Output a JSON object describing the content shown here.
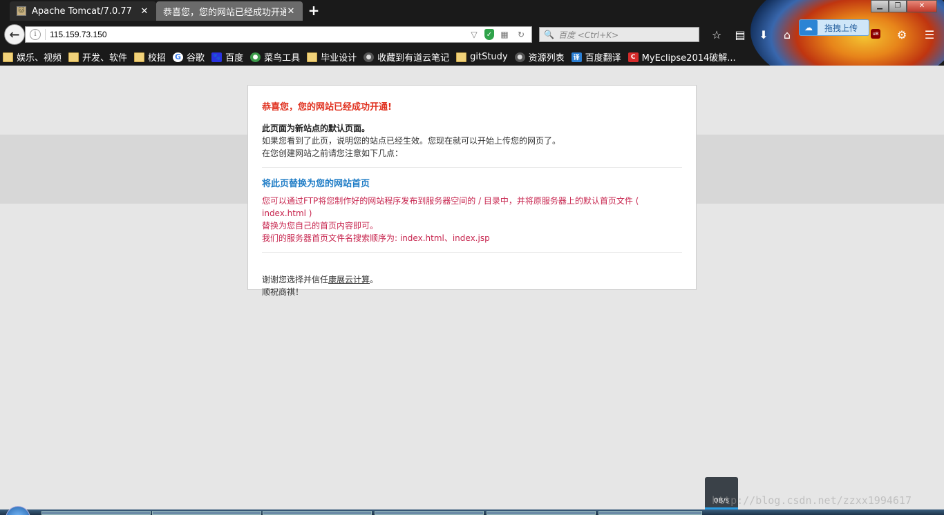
{
  "tabs": [
    {
      "title": "Apache Tomcat/7.0.77",
      "active": false
    },
    {
      "title": "恭喜您，您的网站已经成功开通!",
      "active": true
    }
  ],
  "url": "115.159.73.150",
  "search_placeholder": "百度 <Ctrl+K>",
  "upload_label": "拖拽上传",
  "bookmarks": [
    {
      "label": "娱乐、视频",
      "icon": "folder-icon"
    },
    {
      "label": "开发、软件",
      "icon": "folder-icon"
    },
    {
      "label": "校招",
      "icon": "folder-icon"
    },
    {
      "label": "谷歌",
      "icon": "google-icon"
    },
    {
      "label": "百度",
      "icon": "baidu-icon"
    },
    {
      "label": "菜鸟工具",
      "icon": "runoob-icon"
    },
    {
      "label": "毕业设计",
      "icon": "folder-icon"
    },
    {
      "label": "收藏到有道云笔记",
      "icon": "youdao-icon"
    },
    {
      "label": "gitStudy",
      "icon": "folder-icon"
    },
    {
      "label": "资源列表",
      "icon": "globe-icon"
    },
    {
      "label": "百度翻译",
      "icon": "translate-icon"
    },
    {
      "label": "MyEclipse2014破解...",
      "icon": "csdn-icon"
    }
  ],
  "page": {
    "heading": "恭喜您，您的网站已经成功开通!",
    "intro_bold": "此页面为新站点的默认页面。",
    "intro_lines": [
      "如果您看到了此页，说明您的站点已经生效。您现在就可以开始上传您的网页了。",
      "在您创建网站之前请您注意如下几点："
    ],
    "section_title": "将此页替换为您的网站首页",
    "section_lines": [
      "您可以通过FTP将您制作好的网站程序发布到服务器空间的 / 目录中，并将原服务器上的默认首页文件 ( index.html )",
      "替换为您自己的首页内容即可。",
      "我们的服务器首页文件名搜索顺序为: index.html、index.jsp"
    ],
    "thanks_prefix": "谢谢您选择并信任",
    "thanks_link": "康展云计算",
    "thanks_suffix": "。",
    "closing": "顺祝商祺！"
  },
  "speed_label": "0B/s",
  "watermark": "http://blog.csdn.net/zzxx1994617"
}
